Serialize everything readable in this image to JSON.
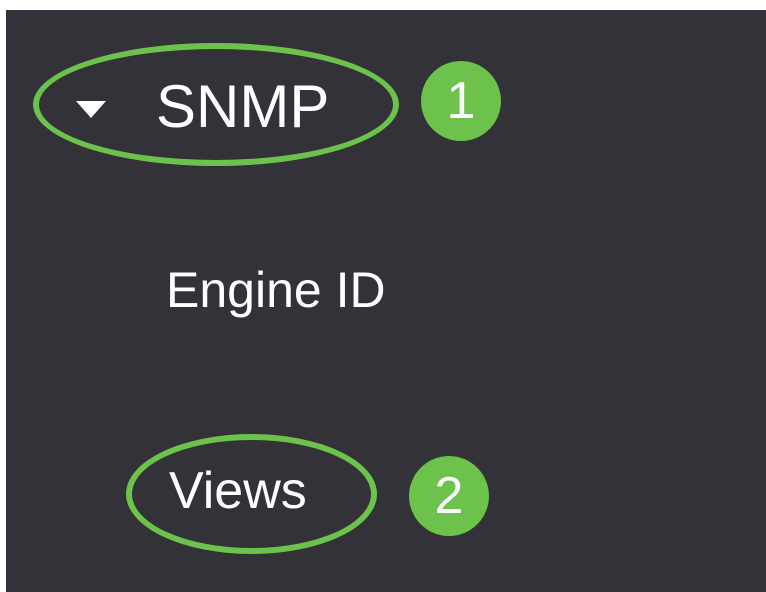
{
  "nav": {
    "snmp": {
      "label": "SNMP",
      "expand_icon": "caret-down-icon",
      "expanded": true
    },
    "items": [
      {
        "label": "Engine ID"
      },
      {
        "label": "Views"
      }
    ]
  },
  "annotations": {
    "steps": [
      "1",
      "2"
    ],
    "highlight_color": "#6cc24a"
  },
  "colors": {
    "panel_background": "#323238",
    "text": "#ffffff"
  }
}
